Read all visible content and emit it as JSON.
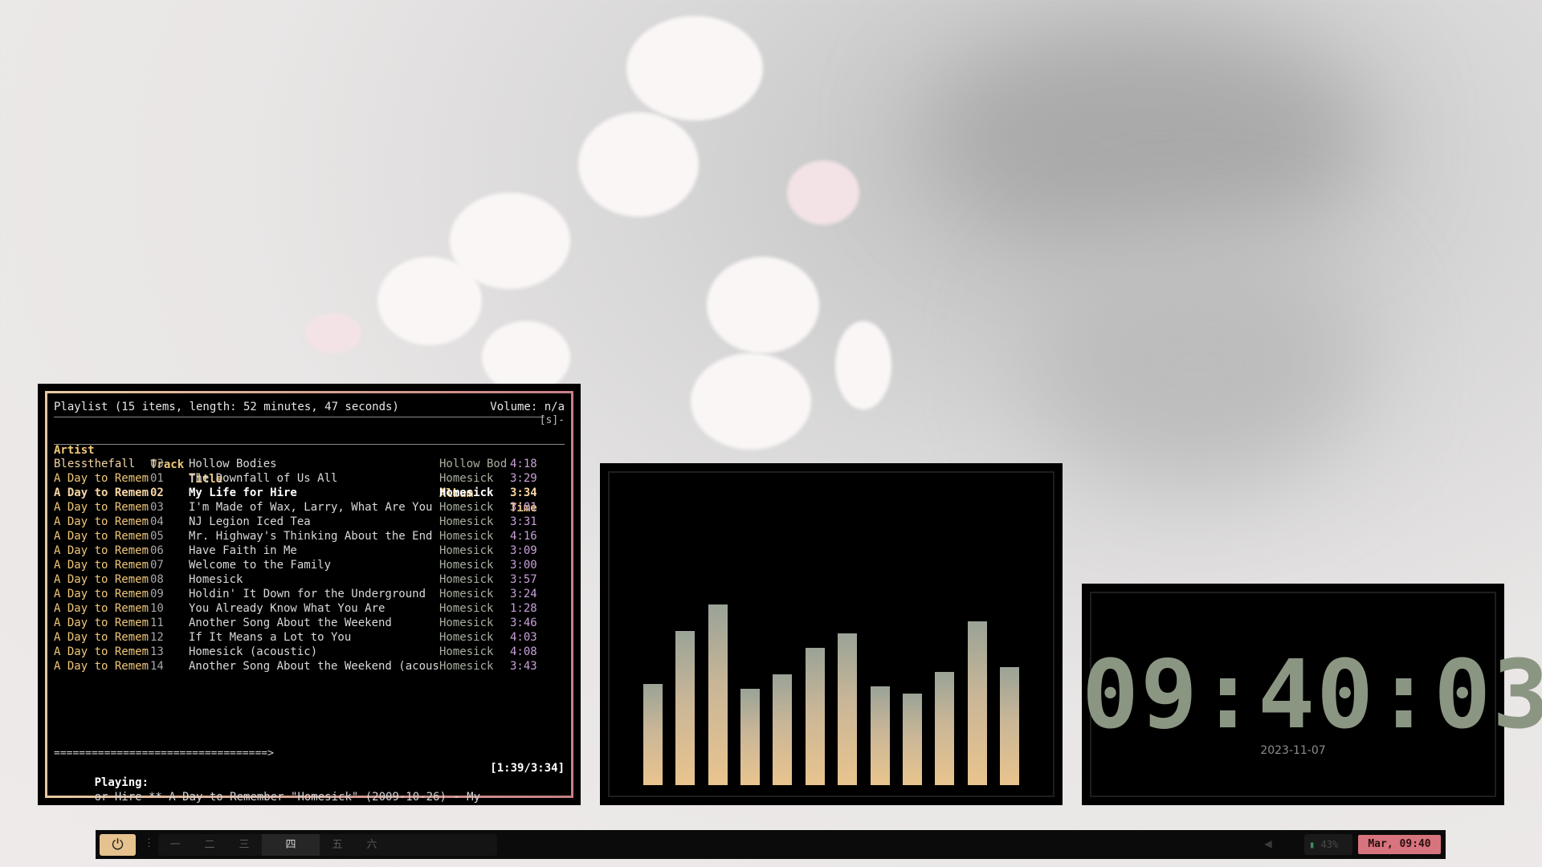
{
  "playlist": {
    "header": "Playlist (15 items, length: 52 minutes, 47 seconds)",
    "volume": "Volume: n/a",
    "s_indicator": "[s]-",
    "columns": {
      "artist": "Artist",
      "track": "Track",
      "title": "Title",
      "album": "Album",
      "time": "Time"
    },
    "rows": [
      {
        "artist": "Blessthefall",
        "track": "03",
        "title": "Hollow Bodies",
        "album": "Hollow Bod",
        "time": "4:18"
      },
      {
        "artist": "A Day to Remem",
        "track": "01",
        "title": "The Downfall of Us All",
        "album": "Homesick",
        "time": "3:29"
      },
      {
        "artist": "A Day to Remem",
        "track": "02",
        "title": "My Life for Hire",
        "album": "Homesick",
        "time": "3:34",
        "current": true
      },
      {
        "artist": "A Day to Remem",
        "track": "03",
        "title": "I'm Made of Wax, Larry, What Are You M",
        "album": "Homesick",
        "time": "3:01"
      },
      {
        "artist": "A Day to Remem",
        "track": "04",
        "title": "NJ Legion Iced Tea",
        "album": "Homesick",
        "time": "3:31"
      },
      {
        "artist": "A Day to Remem",
        "track": "05",
        "title": "Mr. Highway's Thinking About the End",
        "album": "Homesick",
        "time": "4:16"
      },
      {
        "artist": "A Day to Remem",
        "track": "06",
        "title": "Have Faith in Me",
        "album": "Homesick",
        "time": "3:09"
      },
      {
        "artist": "A Day to Remem",
        "track": "07",
        "title": "Welcome to the Family",
        "album": "Homesick",
        "time": "3:00"
      },
      {
        "artist": "A Day to Remem",
        "track": "08",
        "title": "Homesick",
        "album": "Homesick",
        "time": "3:57"
      },
      {
        "artist": "A Day to Remem",
        "track": "09",
        "title": "Holdin' It Down for the Underground",
        "album": "Homesick",
        "time": "3:24"
      },
      {
        "artist": "A Day to Remem",
        "track": "10",
        "title": "You Already Know What You Are",
        "album": "Homesick",
        "time": "1:28"
      },
      {
        "artist": "A Day to Remem",
        "track": "11",
        "title": "Another Song About the Weekend",
        "album": "Homesick",
        "time": "3:46"
      },
      {
        "artist": "A Day to Remem",
        "track": "12",
        "title": "If It Means a Lot to You",
        "album": "Homesick",
        "time": "4:03"
      },
      {
        "artist": "A Day to Remem",
        "track": "13",
        "title": "Homesick (acoustic)",
        "album": "Homesick",
        "time": "4:08"
      },
      {
        "artist": "A Day to Remem",
        "track": "14",
        "title": "Another Song About the Weekend (acoust",
        "album": "Homesick",
        "time": "3:43"
      }
    ],
    "progress_bar": "==================================>",
    "playing_label": "Playing:",
    "playing_text": "or Hire ** A Day to Remember \"Homesick\" (2009-10-26) - My",
    "position": "[1:39/3:34]"
  },
  "visualizer": {
    "levels": [
      0.42,
      0.64,
      0.75,
      0.4,
      0.46,
      0.57,
      0.63,
      0.41,
      0.38,
      0.47,
      0.68,
      0.49
    ]
  },
  "clock": {
    "time": "09:40:03",
    "date": "2023-11-07"
  },
  "taskbar": {
    "power_icon": "⏻",
    "dots": "⋮",
    "workspaces": [
      "一",
      "二",
      "三",
      "四",
      "五",
      "六"
    ],
    "active_workspace": 3,
    "chevron_icon": "◀",
    "battery_icon": "▮",
    "battery": "43%",
    "datetime": "Mar, 09:40"
  },
  "colors": {
    "accent_gold": "#f0c878",
    "accent_pink": "#d7747e",
    "clock_green": "#8a9682"
  }
}
